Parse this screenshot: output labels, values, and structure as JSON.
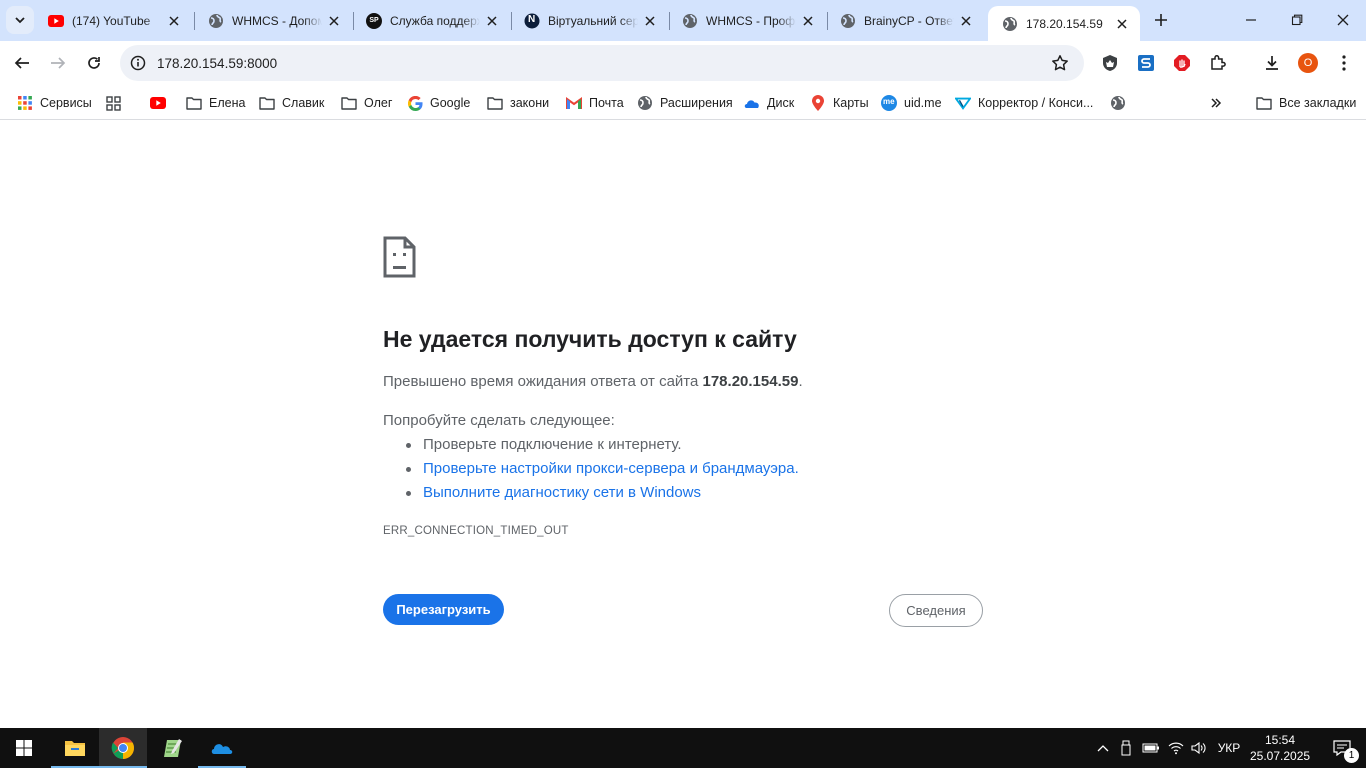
{
  "tabs": [
    {
      "title": "(174) YouTube",
      "icon": "youtube-icon"
    },
    {
      "title": "WHMCS - Допомога",
      "icon": "globe-icon"
    },
    {
      "title": "Служба поддержки",
      "icon": "sp-icon",
      "icon_text": "SP"
    },
    {
      "title": "Віртуальний сервер",
      "icon": "n-icon",
      "icon_text": "N"
    },
    {
      "title": "WHMCS - Профіль",
      "icon": "globe-icon"
    },
    {
      "title": "BrainyCP - Ответы",
      "icon": "globe-icon"
    },
    {
      "title": "178.20.154.59",
      "icon": "globe-icon",
      "active": true
    }
  ],
  "address_bar": {
    "url": "178.20.154.59:8000"
  },
  "bookmarks": [
    {
      "label": "Сервисы",
      "icon": "apps-grid-icon"
    },
    {
      "label": "",
      "icon": "apps-icon"
    },
    {
      "label": "",
      "icon": "youtube-icon"
    },
    {
      "label": "Елена",
      "icon": "folder-icon"
    },
    {
      "label": "Славик",
      "icon": "folder-icon"
    },
    {
      "label": "Олег",
      "icon": "folder-icon"
    },
    {
      "label": "Google",
      "icon": "google-icon"
    },
    {
      "label": "закони",
      "icon": "folder-icon"
    },
    {
      "label": "Почта",
      "icon": "gmail-icon"
    },
    {
      "label": "Расширения",
      "icon": "globe-icon"
    },
    {
      "label": "Диск",
      "icon": "disk-icon"
    },
    {
      "label": "Карты",
      "icon": "maps-pin-icon"
    },
    {
      "label": "uid.me",
      "icon": "uidme-icon",
      "icon_text": "me"
    },
    {
      "label": "Корректор / Конси...",
      "icon": "corrector-icon"
    },
    {
      "label": "",
      "icon": "globe-icon"
    }
  ],
  "all_bookmarks_label": "Все закладки",
  "avatar_letter": "O",
  "error": {
    "title": "Не удается получить доступ к сайту",
    "desc_prefix": "Превышено время ожидания ответа от сайта ",
    "desc_host": "178.20.154.59",
    "desc_suffix": ".",
    "try_label": "Попробуйте сделать следующее:",
    "suggestions": [
      "Проверьте подключение к интернету.",
      "Проверьте настройки прокси-сервера и брандмауэра.",
      "Выполните диагностику сети в Windows"
    ],
    "code": "ERR_CONNECTION_TIMED_OUT",
    "reload_label": "Перезагрузить",
    "details_label": "Сведения"
  },
  "taskbar": {
    "language": "УКР",
    "time": "15:54",
    "date": "25.07.2025",
    "notifications_count": "1"
  },
  "colors": {
    "tabstrip_bg": "#d3e3fd",
    "link": "#1a73e8",
    "primary_button": "#1a73e8",
    "taskbar": "#101010",
    "avatar": "#e8540f"
  }
}
